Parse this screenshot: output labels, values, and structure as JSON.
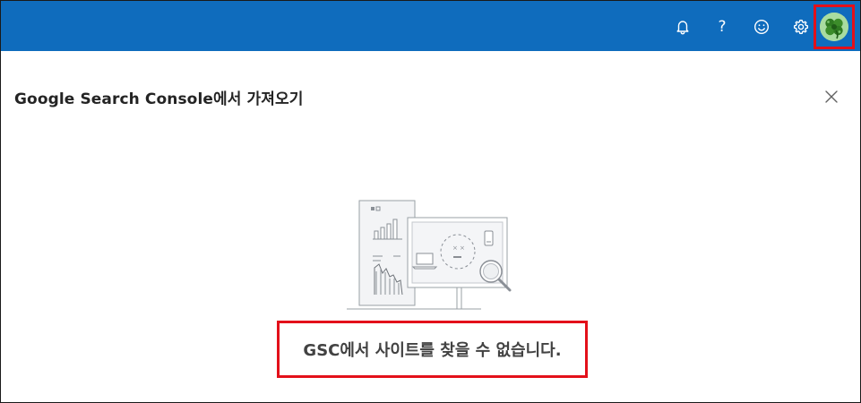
{
  "topbar": {
    "background": "#0f6cbd",
    "icons": [
      {
        "name": "bell-icon"
      },
      {
        "name": "help-icon",
        "glyph": "?"
      },
      {
        "name": "smiley-icon"
      },
      {
        "name": "gear-icon"
      }
    ],
    "avatar": {
      "name": "clover-avatar"
    }
  },
  "dialog": {
    "title": "Google Search Console에서 가져오기",
    "close_icon": "close-icon",
    "illustration": "empty-state-illustration",
    "message": "GSC에서 사이트를 찾을 수 없습니다."
  },
  "colors": {
    "accent": "#0f6cbd",
    "highlight": "#e3101a",
    "title_text": "#242424",
    "message_text": "#424242"
  }
}
